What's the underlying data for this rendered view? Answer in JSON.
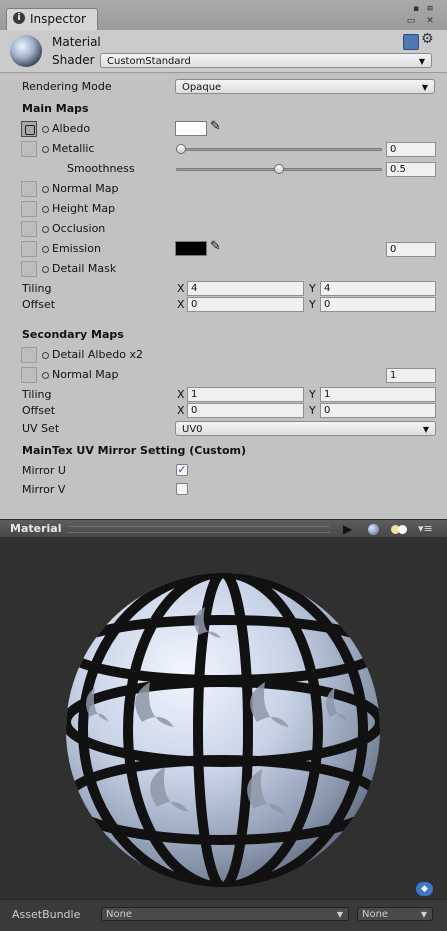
{
  "window": {
    "tab_label": "Inspector"
  },
  "header": {
    "title": "Material",
    "shader_label": "Shader",
    "shader_value": "CustomStandard"
  },
  "rendering_mode": {
    "label": "Rendering Mode",
    "value": "Opaque"
  },
  "main_maps": {
    "heading": "Main Maps",
    "albedo": {
      "label": "Albedo",
      "color": "#ffffff"
    },
    "metallic": {
      "label": "Metallic",
      "value": "0",
      "level": 0
    },
    "smoothness": {
      "label": "Smoothness",
      "value": "0.5",
      "level": 0.5
    },
    "normal_map": {
      "label": "Normal Map"
    },
    "height_map": {
      "label": "Height Map"
    },
    "occlusion": {
      "label": "Occlusion"
    },
    "emission": {
      "label": "Emission",
      "color": "#000000",
      "value": "0"
    },
    "detail_mask": {
      "label": "Detail Mask"
    },
    "tiling": {
      "label": "Tiling",
      "x_label": "X",
      "x": "4",
      "y_label": "Y",
      "y": "4"
    },
    "offset": {
      "label": "Offset",
      "x_label": "X",
      "x": "0",
      "y_label": "Y",
      "y": "0"
    }
  },
  "secondary_maps": {
    "heading": "Secondary Maps",
    "detail_albedo": {
      "label": "Detail Albedo x2"
    },
    "normal_map": {
      "label": "Normal Map",
      "value": "1"
    },
    "tiling": {
      "label": "Tiling",
      "x_label": "X",
      "x": "1",
      "y_label": "Y",
      "y": "1"
    },
    "offset": {
      "label": "Offset",
      "x_label": "X",
      "x": "0",
      "y_label": "Y",
      "y": "0"
    },
    "uv_set": {
      "label": "UV Set",
      "value": "UV0"
    }
  },
  "mirror": {
    "heading": "MainTex UV Mirror Setting (Custom)",
    "mirror_u": {
      "label": "Mirror U",
      "checked": true
    },
    "mirror_v": {
      "label": "Mirror V",
      "checked": false
    }
  },
  "preview": {
    "title": "Material"
  },
  "asset_bundle": {
    "label": "AssetBundle",
    "name_value": "None",
    "variant_value": "None"
  },
  "colors": {
    "panel": "#c2c2c2",
    "preview_bg": "#303030",
    "checkmark": "#2a4fbf"
  }
}
